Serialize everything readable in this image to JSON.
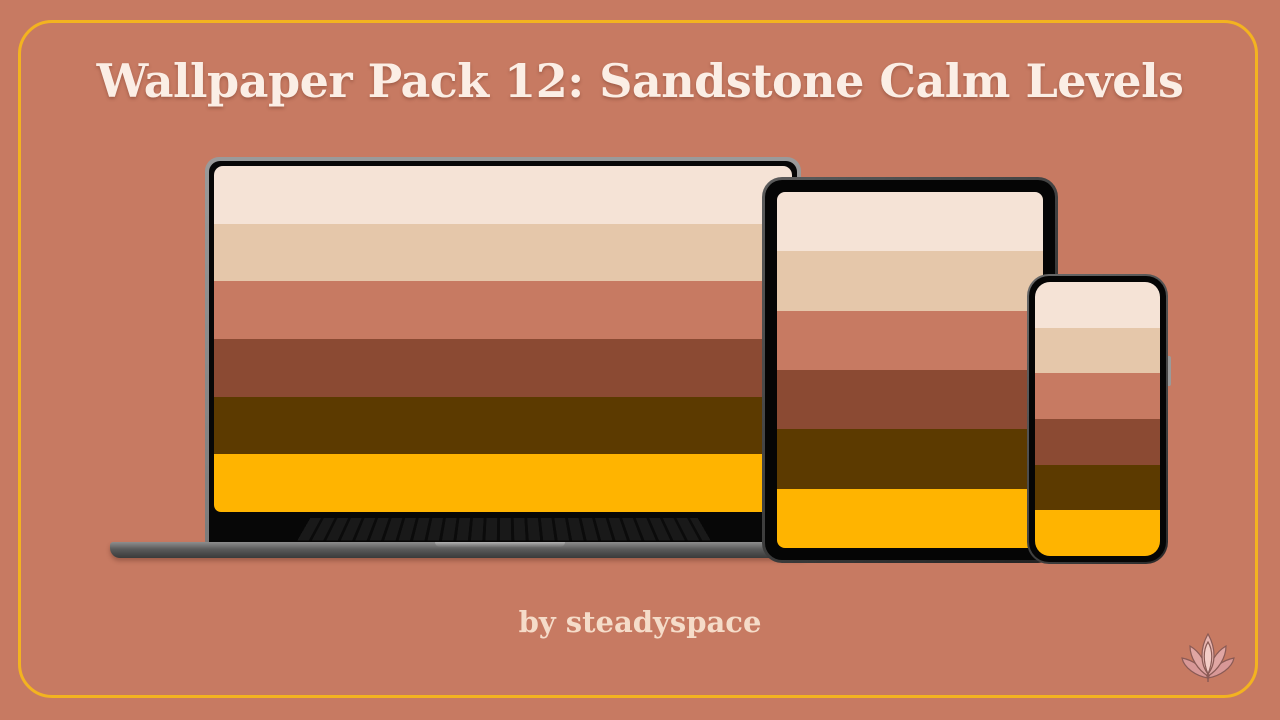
{
  "title": "Wallpaper Pack 12: Sandstone Calm Levels",
  "byline": "by steadyspace",
  "colors": {
    "background": "#c77a62",
    "frame_border": "#f3b320",
    "title_text": "#fbeee5",
    "byline_text": "#f5dcc9"
  },
  "palette": [
    "#f5e3d6",
    "#e5c7aa",
    "#c77a62",
    "#8b4a33",
    "#5c3a00",
    "#ffb400"
  ],
  "devices": [
    "laptop",
    "tablet",
    "phone"
  ],
  "icons": {
    "logo": "lotus-icon"
  }
}
